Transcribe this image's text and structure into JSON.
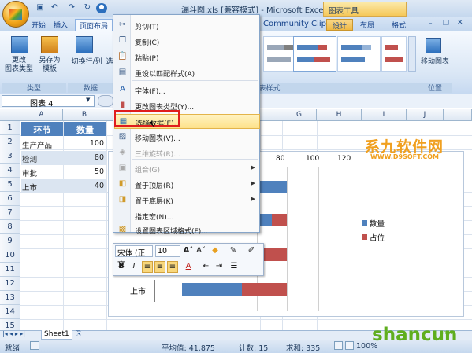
{
  "window": {
    "title": "漏斗图.xls [兼容模式] - Microsoft Excel",
    "chart_tools": "图表工具"
  },
  "tabs": [
    {
      "label": "开始"
    },
    {
      "label": "插入"
    },
    {
      "label": "页面布局"
    },
    {
      "label": "Community Clips"
    },
    {
      "label": "设计"
    },
    {
      "label": "布局"
    },
    {
      "label": "格式"
    }
  ],
  "ribbon": {
    "change_type": "更改\n图表类型",
    "save_template": "另存为\n模板",
    "group_type": "类型",
    "switch_row_col": "切换行/列",
    "select_data": "选",
    "group_data": "数据",
    "group_styles": "图表样式",
    "move_chart": "移动图表",
    "group_location": "位置"
  },
  "namebox": {
    "value": "图表 4"
  },
  "columns": [
    "A",
    "B",
    "C",
    "D",
    "E",
    "F",
    "G",
    "H",
    "I",
    "J"
  ],
  "rows": [
    "1",
    "2",
    "3",
    "4",
    "5",
    "6",
    "7",
    "8",
    "9",
    "10",
    "11",
    "12",
    "13",
    "14",
    "15",
    "16"
  ],
  "table": {
    "headers": [
      "环节",
      "数量"
    ],
    "rows": [
      {
        "name": "生产产品",
        "value": "100"
      },
      {
        "name": "检测",
        "value": "80"
      },
      {
        "name": "审批",
        "value": "50"
      },
      {
        "name": "上市",
        "value": "40"
      }
    ]
  },
  "chart_data": {
    "type": "bar",
    "stacked": true,
    "orientation": "horizontal",
    "categories": [
      "生产产品",
      "检测",
      "审批",
      "上市"
    ],
    "series": [
      {
        "name": "数量",
        "values": [
          100,
          80,
          50,
          40
        ],
        "color": "#4f81bd"
      },
      {
        "name": "占位",
        "values": [
          0,
          10,
          25,
          30
        ],
        "color": "#c0504d"
      }
    ],
    "x_ticks": [
      "80",
      "100",
      "120"
    ],
    "visible_category_label": "上市",
    "legend_position": "right"
  },
  "context_menu": {
    "items": [
      {
        "label": "剪切(T)",
        "icon": "scissors-icon",
        "disabled": false
      },
      {
        "label": "复制(C)",
        "icon": "copy-icon",
        "disabled": false
      },
      {
        "label": "粘贴(P)",
        "icon": "paste-icon",
        "disabled": false
      },
      {
        "label": "重设以匹配样式(A)",
        "icon": "reset-style-icon",
        "disabled": false
      },
      {
        "label": "字体(F)...",
        "icon": "font-icon",
        "disabled": false
      },
      {
        "label": "更改图表类型(Y)...",
        "icon": "chart-type-icon",
        "disabled": false
      },
      {
        "label": "选择数据(E)...",
        "icon": "select-data-icon",
        "disabled": false
      },
      {
        "label": "移动图表(V)...",
        "icon": "move-chart-icon",
        "disabled": false
      },
      {
        "label": "三维旋转(R)...",
        "icon": "rotate-3d-icon",
        "disabled": true
      },
      {
        "label": "组合(G)",
        "icon": "group-icon",
        "disabled": true
      },
      {
        "label": "置于顶层(R)",
        "icon": "bring-front-icon",
        "disabled": false
      },
      {
        "label": "置于底层(K)",
        "icon": "send-back-icon",
        "disabled": false
      },
      {
        "label": "指定宏(N)...",
        "icon": "macro-icon",
        "disabled": false
      },
      {
        "label": "设置图表区域格式(F)...",
        "icon": "format-chart-area-icon",
        "disabled": false
      }
    ]
  },
  "mini_toolbar": {
    "font": "宋体 (正文",
    "size": "10"
  },
  "sheet_tab": "Sheet1",
  "status": {
    "ready": "就绪",
    "average": "平均值: 41.875",
    "count": "计数: 15",
    "sum": "求和: 335",
    "zoom": "100%"
  },
  "watermark_top": {
    "brand": "系九软件网",
    "url": "WWW.D9SOFT.COM"
  },
  "watermark_bottom": {
    "brand": "shancun",
    "sub": ".net"
  }
}
